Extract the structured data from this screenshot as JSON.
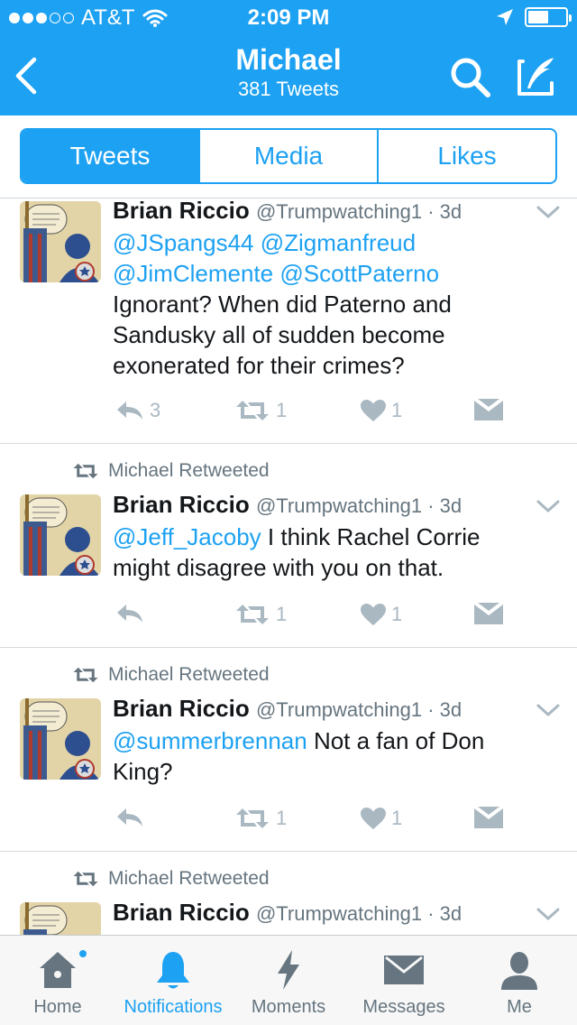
{
  "status_bar": {
    "carrier": "AT&T",
    "time": "2:09 PM"
  },
  "header": {
    "title": "Michael",
    "subtitle": "381 Tweets"
  },
  "tabs": [
    {
      "label": "Tweets",
      "active": true
    },
    {
      "label": "Media",
      "active": false
    },
    {
      "label": "Likes",
      "active": false
    }
  ],
  "tweets": [
    {
      "retweeted_by": "",
      "author": "Brian Riccio",
      "handle": "@Trumpwatching1 · 3d",
      "mentions": [
        "@JSpangs44",
        "@Zigmanfreud",
        "@JimClemente",
        "@ScottPaterno"
      ],
      "text": "Ignorant? When did Paterno and Sandusky all of sudden become exonerated for their crimes?",
      "replies": "3",
      "retweets": "1",
      "likes": "1"
    },
    {
      "retweeted_by": "Michael Retweeted",
      "author": "Brian Riccio",
      "handle": "@Trumpwatching1 · 3d",
      "mentions": [
        "@Jeff_Jacoby"
      ],
      "text": " I think Rachel Corrie might disagree with you on that.",
      "replies": "",
      "retweets": "1",
      "likes": "1"
    },
    {
      "retweeted_by": "Michael Retweeted",
      "author": "Brian Riccio",
      "handle": "@Trumpwatching1 · 3d",
      "mentions": [
        "@summerbrennan"
      ],
      "text": " Not a fan of Don King?",
      "replies": "",
      "retweets": "1",
      "likes": "1"
    },
    {
      "retweeted_by": "Michael Retweeted",
      "author": "Brian Riccio",
      "handle": "@Trumpwatching1 · 3d"
    }
  ],
  "tabbar": [
    {
      "label": "Home",
      "icon": "home-icon"
    },
    {
      "label": "Notifications",
      "icon": "bell-icon",
      "active": true
    },
    {
      "label": "Moments",
      "icon": "lightning-icon"
    },
    {
      "label": "Messages",
      "icon": "envelope-icon"
    },
    {
      "label": "Me",
      "icon": "person-icon"
    }
  ],
  "colors": {
    "brand": "#1da1f2",
    "muted": "#66757f",
    "icon_gray": "#aab8c2"
  }
}
